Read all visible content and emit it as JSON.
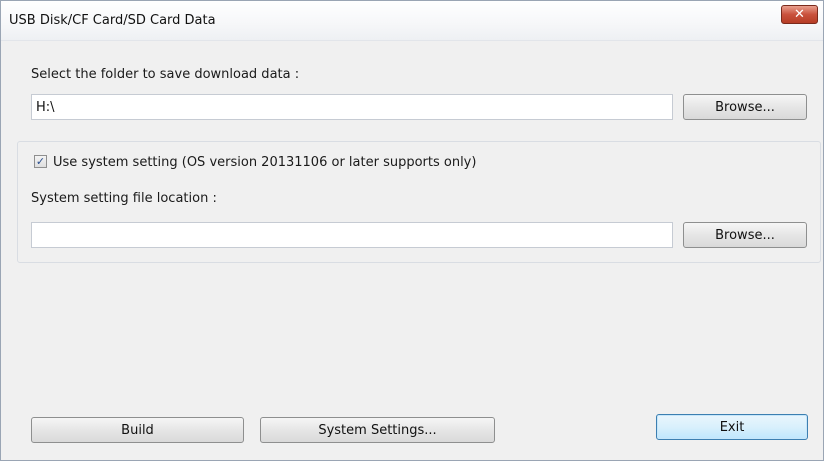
{
  "window": {
    "title": "USB Disk/CF Card/SD Card Data",
    "close_label": "✕"
  },
  "download": {
    "label": "Select the folder to save download data :",
    "path_value": "H:\\",
    "browse_label": "Browse..."
  },
  "system_setting": {
    "checkbox_checked": true,
    "checkbox_label": "Use system setting (OS version 20131106 or later supports only)",
    "file_location_label": "System setting file location :",
    "file_location_value": "",
    "browse_label": "Browse..."
  },
  "footer": {
    "build_label": "Build",
    "system_settings_label": "System Settings...",
    "exit_label": "Exit"
  }
}
